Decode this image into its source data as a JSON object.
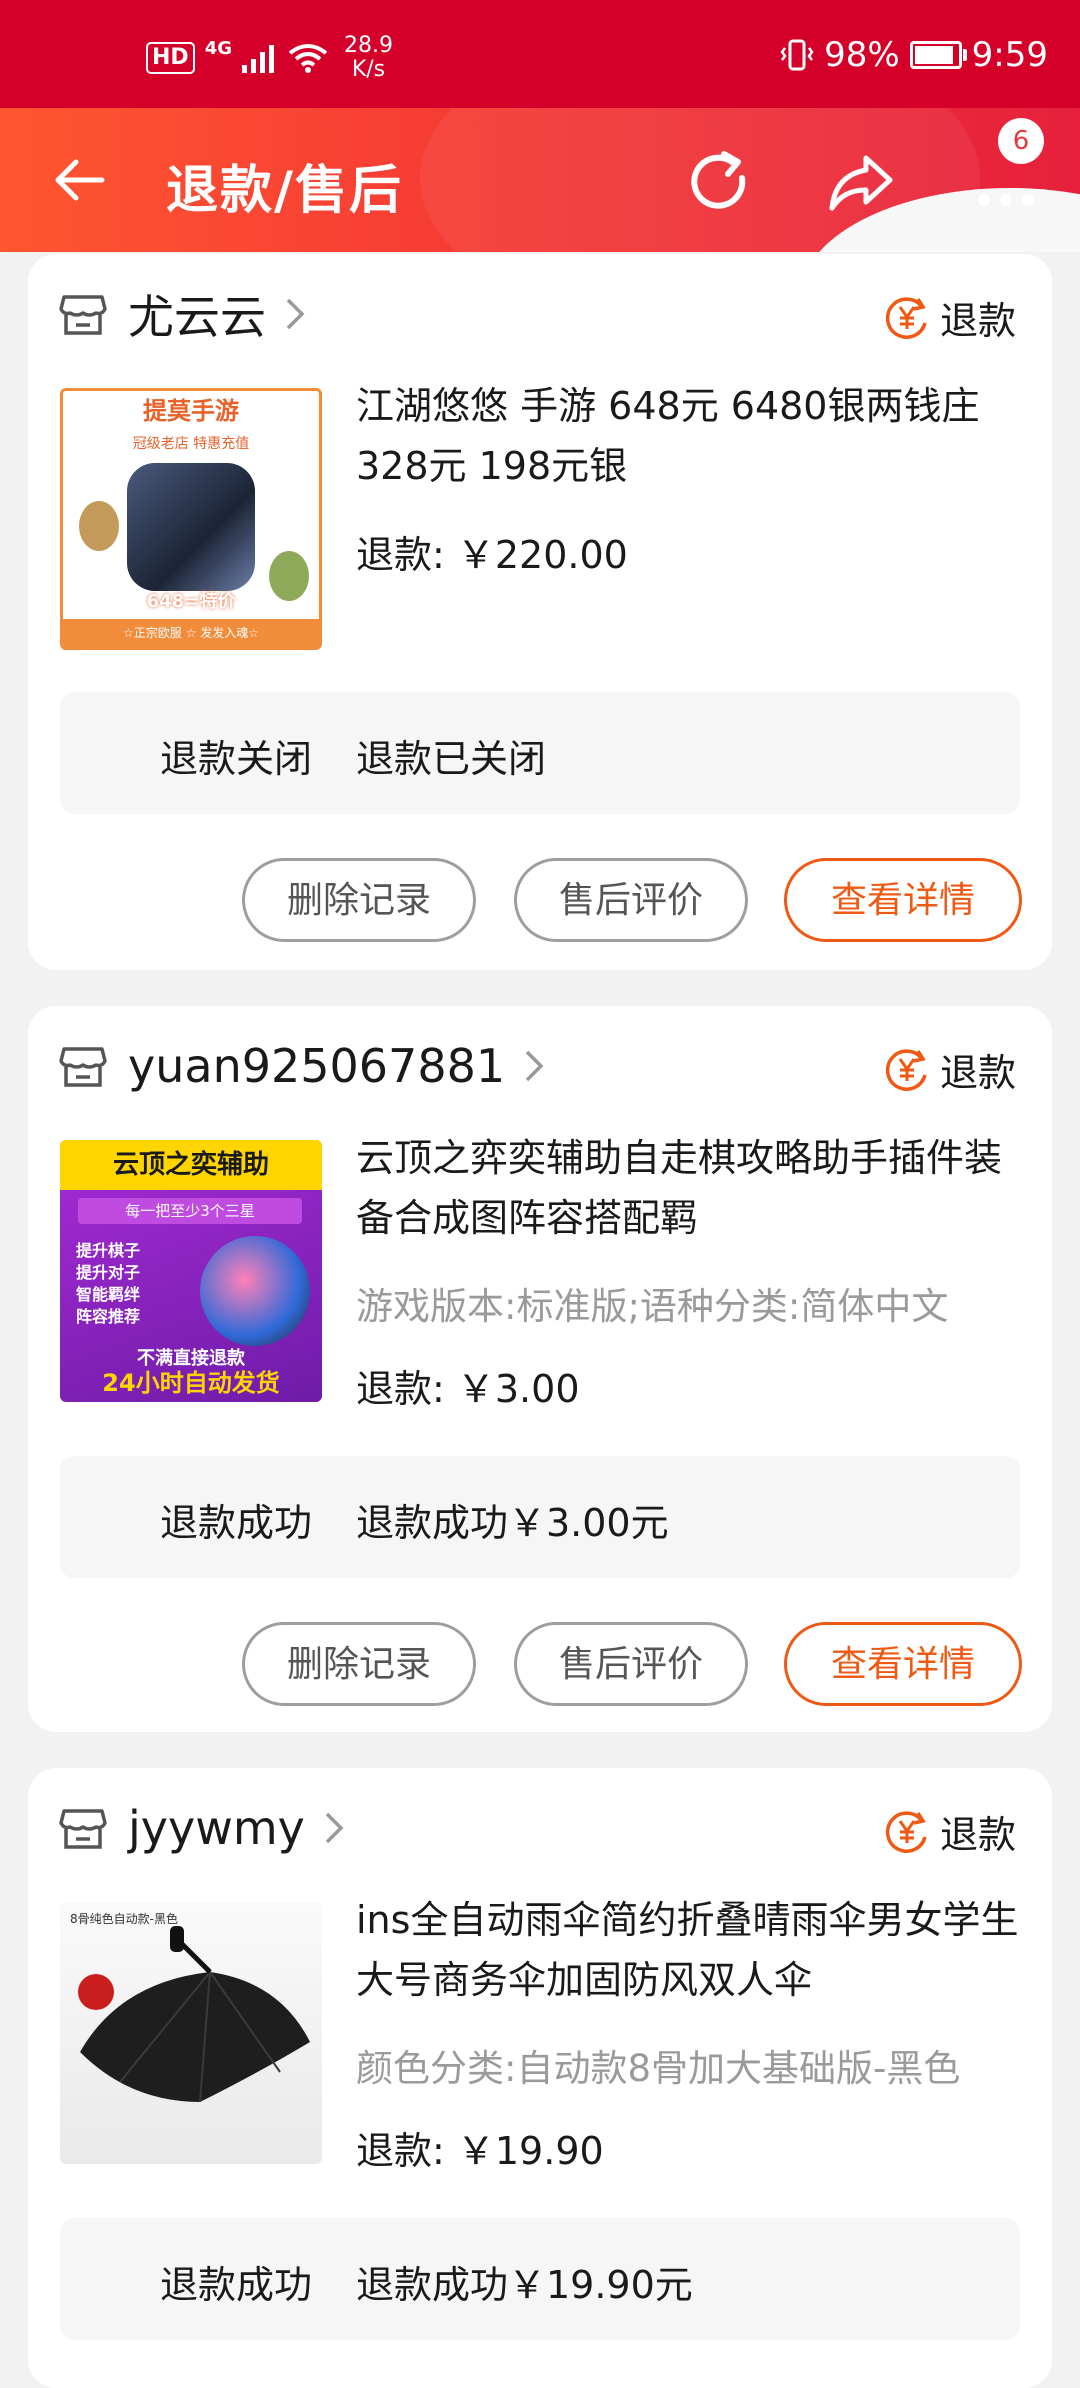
{
  "status_bar": {
    "hd": "HD",
    "network": "4G",
    "speed_value": "28.9",
    "speed_unit": "K/s",
    "battery": "98%",
    "time": "9:59"
  },
  "header": {
    "title": "退款/售后",
    "badge_count": "6"
  },
  "orders": [
    {
      "shop": "尤云云",
      "status": "退款",
      "thumb_title": "提莫手游",
      "thumb_subtitle": "冠级老店 特惠充值",
      "thumb_price": "648=特价",
      "thumb_footer": "☆正宗欧服 ☆ 发发入魂☆",
      "title": "江湖悠悠 手游 648元 6480银两钱庄328元 198元银",
      "variant": "",
      "refund": "退款: ￥220.00",
      "info_label": "退款关闭",
      "info_value": "退款已关闭",
      "btn_delete": "删除记录",
      "btn_review": "售后评价",
      "btn_detail": "查看详情"
    },
    {
      "shop": "yuan925067881",
      "status": "退款",
      "thumb_title": "云顶之奕辅助",
      "thumb_subtitle": "每一把至少3个三星",
      "thumb_lines": [
        "提升棋子",
        "提升对子",
        "智能羁绊",
        "阵容推荐"
      ],
      "thumb_notice": "不满直接退款",
      "thumb_footer": "24小时自动发货",
      "title": "云顶之弈奕辅助自走棋攻略助手插件装备合成图阵容搭配羁",
      "variant": "游戏版本:标准版;语种分类:简体中文",
      "refund": "退款: ￥3.00",
      "info_label": "退款成功",
      "info_value": "退款成功￥3.00元",
      "btn_delete": "删除记录",
      "btn_review": "售后评价",
      "btn_detail": "查看详情"
    },
    {
      "shop": "jyywmy",
      "status": "退款",
      "thumb_caption": "8骨纯色自动款-黑色",
      "title": "ins全自动雨伞简约折叠晴雨伞男女学生大号商务伞加固防风双人伞",
      "variant": "颜色分类:自动款8骨加大基础版-黑色",
      "refund": "退款: ￥19.90",
      "info_label": "退款成功",
      "info_value": "退款成功￥19.90元"
    }
  ],
  "colors": {
    "status_bar": "#d4002a",
    "header_start": "#ff5530",
    "header_end": "#e6203c",
    "accent_orange": "#ee5a14"
  },
  "icons": [
    "back-arrow-icon",
    "refresh-icon",
    "share-icon",
    "more-icon",
    "shop-icon",
    "chevron-right-icon",
    "refund-yen-icon"
  ]
}
